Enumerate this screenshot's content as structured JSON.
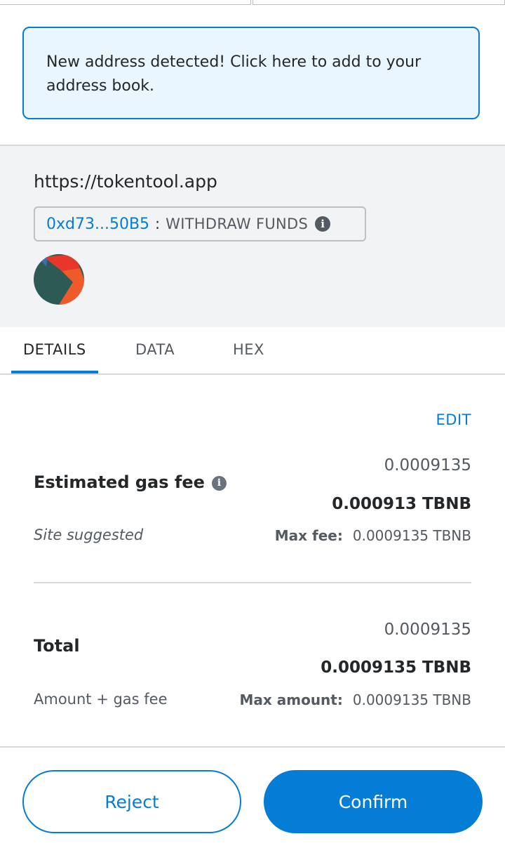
{
  "banner": {
    "text": "New address detected! Click here to add to your address book."
  },
  "origin": "https://tokentool.app",
  "method_pill": {
    "address": "0xd73...50B5",
    "separator": ":",
    "method": "WITHDRAW FUNDS",
    "info_icon": "info-icon"
  },
  "tabs": [
    {
      "label": "DETAILS",
      "active": true
    },
    {
      "label": "DATA",
      "active": false
    },
    {
      "label": "HEX",
      "active": false
    }
  ],
  "details": {
    "edit_label": "EDIT",
    "gas": {
      "label": "Estimated gas fee",
      "secondary_value": "0.0009135",
      "primary_value": "0.000913 TBNB",
      "subtext": "Site suggested",
      "max_label": "Max fee:",
      "max_value": "0.0009135 TBNB"
    },
    "total": {
      "label": "Total",
      "secondary_value": "0.0009135",
      "primary_value": "0.0009135 TBNB",
      "subtext": "Amount + gas fee",
      "max_label": "Max amount:",
      "max_value": "0.0009135 TBNB"
    }
  },
  "buttons": {
    "reject": "Reject",
    "confirm": "Confirm"
  },
  "colors": {
    "accent": "#037dd6",
    "banner_bg": "#eaf6ff",
    "panel_bg": "#f2f3f4"
  }
}
